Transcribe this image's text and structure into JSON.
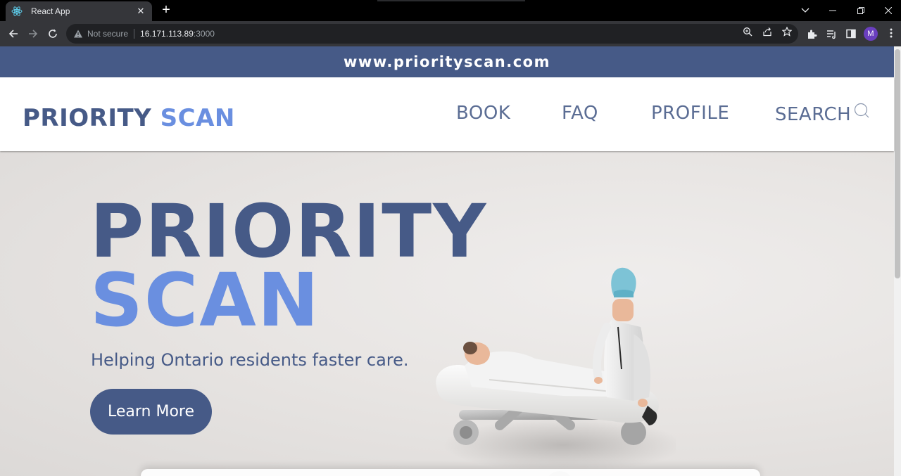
{
  "browser": {
    "tab_title": "React App",
    "tab_close": "✕",
    "new_tab": "+",
    "security_label": "Not secure",
    "url_host": "16.171.113.89",
    "url_port": ":3000",
    "profile_initial": "M",
    "colors": {
      "tabbar": "#000000",
      "toolbar": "#35363a",
      "omnibox": "#202124",
      "avatar": "#6a3fbf"
    }
  },
  "site": {
    "banner_text": "www.priorityscan.com",
    "logo": {
      "part1": "PRIORITY",
      "part2": "SCAN"
    },
    "nav": [
      {
        "label": "BOOK"
      },
      {
        "label": "FAQ"
      },
      {
        "label": "PROFILE"
      },
      {
        "label": "SEARCH"
      }
    ],
    "hero": {
      "title_line1": "PRIORITY",
      "title_line2": "SCAN",
      "subtitle": "Helping Ontario residents faster care.",
      "cta_label": "Learn More"
    },
    "colors": {
      "primary": "#465a87",
      "accent": "#6a8fe0",
      "nav_text": "#5b6d94"
    }
  }
}
